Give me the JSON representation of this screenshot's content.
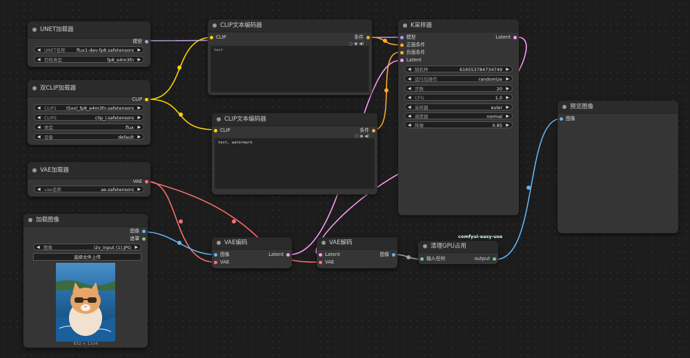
{
  "colors": {
    "model": "#b39ddb",
    "clip": "#ffd500",
    "conditioning": "#ffa931",
    "latent": "#ff9cf9",
    "vae": "#ff6e6e",
    "image": "#64b5f6",
    "any": "#9aa0a6",
    "mask": "#81c784"
  },
  "nodes": {
    "unet": {
      "title": "UNET加载器",
      "out_model": "模型",
      "w1_label": "UNET名称",
      "w1_value": "flux1-dev-fp8.safetensors",
      "w2_label": "剪枝类型",
      "w2_value": "fp8_e4m3fn"
    },
    "dualclip": {
      "title": "双CLIP加载器",
      "out_clip": "CLIP",
      "w1_label": "CLIP1",
      "w1_value": "t5xxl_fp8_e4m3fn.safetensors",
      "w2_label": "CLIP2",
      "w2_value": "clip_l.safetensors",
      "w3_label": "类型",
      "w3_value": "flux",
      "w4_label": "设备",
      "w4_value": "default"
    },
    "vaeloader": {
      "title": "VAE加载器",
      "out_vae": "VAE",
      "w1_label": "vae名称",
      "w1_value": "ae.safetensors"
    },
    "loadimage": {
      "title": "加载图像",
      "out_image": "图像",
      "out_mask": "遮罩",
      "w1_label": "图像",
      "w1_value": "i2v_input (1).JPG",
      "upload_label": "选择文件上传",
      "size_label": "832 × 1104"
    },
    "clip1": {
      "title": "CLIP文本编码器",
      "in_clip": "CLIP",
      "out_cond": "条件",
      "text": "text"
    },
    "clip2": {
      "title": "CLIP文本编码器",
      "in_clip": "CLIP",
      "out_cond": "条件",
      "text": "text, watermark"
    },
    "vaeencode": {
      "title": "VAE编码",
      "in_image": "图像",
      "in_vae": "VAE",
      "out_latent": "Latent"
    },
    "vaedecode": {
      "title": "VAE解码",
      "in_latent": "Latent",
      "in_vae": "VAE",
      "out_image": "图像"
    },
    "ksampler": {
      "title": "K采样器",
      "in_model": "模型",
      "in_pos": "正面条件",
      "in_neg": "负面条件",
      "in_latent": "Latent",
      "out_latent": "Latent",
      "widgets": [
        {
          "label": "随机种",
          "value": "616553784734749"
        },
        {
          "label": "运行后操作",
          "value": "randomize"
        },
        {
          "label": "步数",
          "value": "20"
        },
        {
          "label": "CFG",
          "value": "1.0"
        },
        {
          "label": "采样器",
          "value": "euler"
        },
        {
          "label": "调度器",
          "value": "normal"
        },
        {
          "label": "降噪",
          "value": "0.85"
        }
      ]
    },
    "clearvram": {
      "title": "清理GPU占用",
      "badge": "comfyui-easy-use",
      "in_any": "输入任何",
      "out_output": "output"
    },
    "preview": {
      "title": "预览图像",
      "in_image": "图像"
    }
  }
}
